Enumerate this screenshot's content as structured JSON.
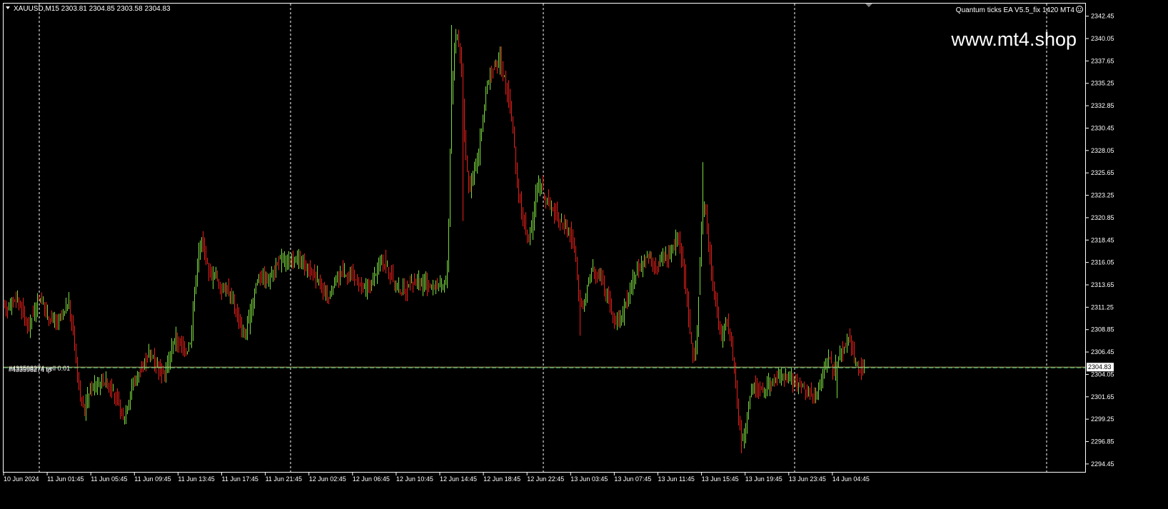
{
  "header": {
    "symbol_info": "XAUUSD,M15  2303.81 2304.85 2303.58 2304.83",
    "ea_label": "Quantum ticks EA  V5.5_fix 1420 MT4",
    "ea_icon": "smiley-icon"
  },
  "watermark": "www.mt4.shop",
  "order_label": "#433598274 sell 0.01",
  "order_label_ghost": "#433598274 tp",
  "colors": {
    "background": "#000000",
    "bull": "#7CDB3F",
    "bear": "#E8201A",
    "grid": "#ffffff",
    "price_line": "#BDB76B",
    "order_line": "#3CB371"
  },
  "chart_data": {
    "type": "candlestick",
    "title": "XAUUSD,M15",
    "ylim": [
      2293.6,
      2343.8
    ],
    "y_ticks": [
      "2342.45",
      "2340.05",
      "2337.65",
      "2335.25",
      "2332.85",
      "2330.45",
      "2328.05",
      "2325.65",
      "2323.25",
      "2320.85",
      "2318.45",
      "2316.05",
      "2313.65",
      "2311.25",
      "2308.85",
      "2306.45",
      "2304.05",
      "2301.65",
      "2299.25",
      "2296.85",
      "2294.45"
    ],
    "x_ticks": [
      "10 Jun 2024",
      "11 Jun 01:45",
      "11 Jun 05:45",
      "11 Jun 09:45",
      "11 Jun 13:45",
      "11 Jun 17:45",
      "11 Jun 21:45",
      "12 Jun 02:45",
      "12 Jun 06:45",
      "12 Jun 10:45",
      "12 Jun 14:45",
      "12 Jun 18:45",
      "12 Jun 22:45",
      "13 Jun 03:45",
      "13 Jun 07:45",
      "13 Jun 11:45",
      "13 Jun 15:45",
      "13 Jun 19:45",
      "13 Jun 23:45",
      "14 Jun 04:45"
    ],
    "current_price": 2304.83,
    "current_price_label": "2304.83",
    "order_price": 2304.83,
    "path": [
      [
        0,
        2312.8
      ],
      [
        8,
        2311.0
      ],
      [
        16,
        2311.8
      ],
      [
        26,
        2312.0
      ],
      [
        34,
        2310.5
      ],
      [
        40,
        2309.0
      ],
      [
        50,
        2311.2
      ],
      [
        56,
        2312.5
      ],
      [
        64,
        2310.8
      ],
      [
        72,
        2310.0
      ],
      [
        82,
        2309.6
      ],
      [
        90,
        2310.5
      ],
      [
        96,
        2312.0
      ],
      [
        100,
        2310.0
      ],
      [
        104,
        2308.0
      ],
      [
        108,
        2305.0
      ],
      [
        112,
        2302.0
      ],
      [
        118,
        2300.0
      ],
      [
        126,
        2302.5
      ],
      [
        136,
        2303.0
      ],
      [
        146,
        2303.5
      ],
      [
        156,
        2302.5
      ],
      [
        166,
        2301.0
      ],
      [
        172,
        2299.0
      ],
      [
        178,
        2300.5
      ],
      [
        186,
        2303.0
      ],
      [
        194,
        2304.0
      ],
      [
        202,
        2305.0
      ],
      [
        210,
        2306.5
      ],
      [
        218,
        2305.5
      ],
      [
        226,
        2304.5
      ],
      [
        232,
        2304.0
      ],
      [
        238,
        2306.0
      ],
      [
        246,
        2308.0
      ],
      [
        254,
        2307.0
      ],
      [
        262,
        2306.5
      ],
      [
        268,
        2308.0
      ],
      [
        272,
        2312.0
      ],
      [
        278,
        2317.0
      ],
      [
        284,
        2318.5
      ],
      [
        290,
        2316.0
      ],
      [
        296,
        2314.5
      ],
      [
        302,
        2315.0
      ],
      [
        310,
        2313.0
      ],
      [
        318,
        2313.5
      ],
      [
        326,
        2312.0
      ],
      [
        334,
        2310.0
      ],
      [
        342,
        2308.0
      ],
      [
        350,
        2310.0
      ],
      [
        358,
        2313.5
      ],
      [
        366,
        2315.0
      ],
      [
        374,
        2314.0
      ],
      [
        382,
        2315.0
      ],
      [
        390,
        2316.0
      ],
      [
        398,
        2316.5
      ],
      [
        406,
        2316.0
      ],
      [
        414,
        2316.5
      ],
      [
        422,
        2316.0
      ],
      [
        430,
        2315.5
      ],
      [
        438,
        2315.0
      ],
      [
        446,
        2314.5
      ],
      [
        454,
        2312.5
      ],
      [
        462,
        2312.0
      ],
      [
        470,
        2314.0
      ],
      [
        478,
        2315.0
      ],
      [
        486,
        2315.0
      ],
      [
        494,
        2314.5
      ],
      [
        502,
        2314.0
      ],
      [
        510,
        2313.0
      ],
      [
        518,
        2313.5
      ],
      [
        526,
        2314.5
      ],
      [
        534,
        2316.5
      ],
      [
        540,
        2316.0
      ],
      [
        546,
        2315.0
      ],
      [
        554,
        2313.5
      ],
      [
        562,
        2313.0
      ],
      [
        570,
        2313.0
      ],
      [
        578,
        2314.0
      ],
      [
        586,
        2314.0
      ],
      [
        594,
        2313.8
      ],
      [
        602,
        2313.5
      ],
      [
        610,
        2313.5
      ],
      [
        618,
        2313.5
      ],
      [
        624,
        2313.8
      ],
      [
        628,
        2316.0
      ],
      [
        632,
        2332.0
      ],
      [
        636,
        2338.0
      ],
      [
        640,
        2341.0
      ],
      [
        646,
        2338.0
      ],
      [
        652,
        2328.0
      ],
      [
        658,
        2324.0
      ],
      [
        664,
        2326.0
      ],
      [
        670,
        2327.0
      ],
      [
        676,
        2331.0
      ],
      [
        682,
        2334.5
      ],
      [
        688,
        2336.0
      ],
      [
        694,
        2337.0
      ],
      [
        700,
        2337.5
      ],
      [
        706,
        2336.0
      ],
      [
        712,
        2334.0
      ],
      [
        718,
        2331.0
      ],
      [
        724,
        2325.0
      ],
      [
        730,
        2322.0
      ],
      [
        736,
        2320.0
      ],
      [
        740,
        2318.0
      ],
      [
        746,
        2320.0
      ],
      [
        752,
        2324.0
      ],
      [
        758,
        2324.5
      ],
      [
        764,
        2323.0
      ],
      [
        772,
        2322.0
      ],
      [
        782,
        2321.0
      ],
      [
        790,
        2320.0
      ],
      [
        798,
        2319.5
      ],
      [
        806,
        2317.0
      ],
      [
        812,
        2312.0
      ],
      [
        818,
        2311.0
      ],
      [
        824,
        2314.0
      ],
      [
        830,
        2315.5
      ],
      [
        836,
        2315.0
      ],
      [
        842,
        2314.5
      ],
      [
        848,
        2313.0
      ],
      [
        854,
        2312.0
      ],
      [
        860,
        2310.0
      ],
      [
        866,
        2309.5
      ],
      [
        872,
        2310.5
      ],
      [
        878,
        2312.0
      ],
      [
        884,
        2313.5
      ],
      [
        890,
        2314.5
      ],
      [
        896,
        2315.5
      ],
      [
        902,
        2316.0
      ],
      [
        908,
        2317.0
      ],
      [
        914,
        2316.0
      ],
      [
        920,
        2315.0
      ],
      [
        926,
        2316.5
      ],
      [
        932,
        2317.0
      ],
      [
        938,
        2316.5
      ],
      [
        944,
        2318.0
      ],
      [
        950,
        2319.0
      ],
      [
        956,
        2316.0
      ],
      [
        962,
        2313.0
      ],
      [
        968,
        2307.5
      ],
      [
        972,
        2306.0
      ],
      [
        976,
        2307.0
      ],
      [
        980,
        2314.0
      ],
      [
        984,
        2322.0
      ],
      [
        988,
        2322.5
      ],
      [
        992,
        2319.0
      ],
      [
        996,
        2316.0
      ],
      [
        1000,
        2313.0
      ],
      [
        1006,
        2310.0
      ],
      [
        1012,
        2308.0
      ],
      [
        1018,
        2310.0
      ],
      [
        1024,
        2308.0
      ],
      [
        1030,
        2304.0
      ],
      [
        1034,
        2300.0
      ],
      [
        1040,
        2297.0
      ],
      [
        1046,
        2299.0
      ],
      [
        1052,
        2302.0
      ],
      [
        1058,
        2303.0
      ],
      [
        1064,
        2302.5
      ],
      [
        1070,
        2302.0
      ],
      [
        1078,
        2303.0
      ],
      [
        1086,
        2303.5
      ],
      [
        1094,
        2304.0
      ],
      [
        1102,
        2303.5
      ],
      [
        1110,
        2303.5
      ],
      [
        1118,
        2303.0
      ],
      [
        1126,
        2302.5
      ],
      [
        1134,
        2302.0
      ],
      [
        1142,
        2301.8
      ],
      [
        1150,
        2303.5
      ],
      [
        1156,
        2305.0
      ],
      [
        1162,
        2306.0
      ],
      [
        1168,
        2304.5
      ],
      [
        1174,
        2305.5
      ],
      [
        1180,
        2306.5
      ],
      [
        1186,
        2307.5
      ],
      [
        1190,
        2308.0
      ],
      [
        1194,
        2307.0
      ],
      [
        1198,
        2305.5
      ],
      [
        1202,
        2305.0
      ],
      [
        1206,
        2304.5
      ],
      [
        1210,
        2304.83
      ]
    ],
    "spikes": [
      [
        632,
        2341.5
      ],
      [
        648,
        2320.5
      ],
      [
        701,
        2339.2
      ],
      [
        812,
        2308.2
      ],
      [
        984,
        2326.8
      ],
      [
        1038,
        2295.6
      ],
      [
        1172,
        2301.5
      ],
      [
        1190,
        2309.0
      ]
    ]
  }
}
